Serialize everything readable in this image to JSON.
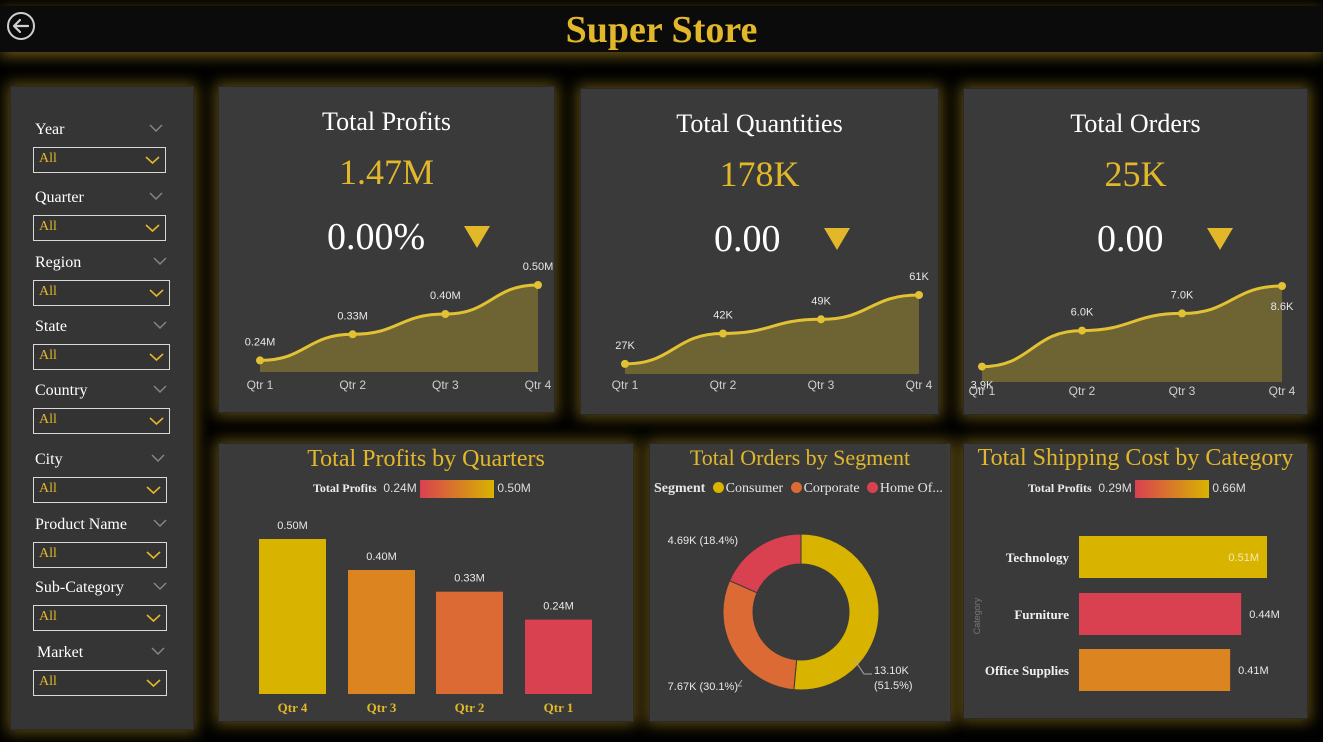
{
  "header": {
    "title": "Super Store"
  },
  "colors": {
    "gold": "#e2b82a",
    "bar_gold": "#d8b400",
    "orange": "#dc8420",
    "dark_orange": "#dc6a34",
    "red": "#d94050",
    "panel": "#3a3a3a"
  },
  "filters": [
    {
      "label": "Year",
      "value": "All"
    },
    {
      "label": "Quarter",
      "value": "All"
    },
    {
      "label": "Region",
      "value": "All"
    },
    {
      "label": "State",
      "value": "All"
    },
    {
      "label": "Country",
      "value": "All"
    },
    {
      "label": "City",
      "value": "All"
    },
    {
      "label": "Product Name",
      "value": "All"
    },
    {
      "label": "Sub-Category",
      "value": "All"
    },
    {
      "label": "Market",
      "value": "All"
    }
  ],
  "kpis": [
    {
      "title": "Total Profits",
      "value": "1.47M",
      "change": "0.00%"
    },
    {
      "title": "Total Quantities",
      "value": "178K",
      "change": "0.00"
    },
    {
      "title": "Total Orders",
      "value": "25K",
      "change": "0.00"
    }
  ],
  "bar_title": "Total Profits by Quarters",
  "bar_legend": {
    "label": "Total Profits",
    "min": "0.24M",
    "max": "0.50M"
  },
  "donut_title": "Total Orders by Segment",
  "donut_legend": {
    "label": "Segment",
    "items": [
      "Consumer",
      "Corporate",
      "Home Of..."
    ]
  },
  "hbar_title": "Total Shipping Cost by Category",
  "hbar_legend": {
    "label": "Total Profits",
    "min": "0.29M",
    "max": "0.66M"
  },
  "chart_data": [
    {
      "type": "area",
      "x": [
        "Qtr 1",
        "Qtr 2",
        "Qtr 3",
        "Qtr 4"
      ],
      "values": [
        0.24,
        0.33,
        0.4,
        0.5
      ],
      "labels": [
        "0.24M",
        "0.33M",
        "0.40M",
        "0.50M"
      ]
    },
    {
      "type": "area",
      "x": [
        "Qtr 1",
        "Qtr 2",
        "Qtr 3",
        "Qtr 4"
      ],
      "values": [
        27,
        42,
        49,
        61
      ],
      "labels": [
        "27K",
        "42K",
        "49K",
        "61K"
      ]
    },
    {
      "type": "area",
      "x": [
        "Qtr 1",
        "Qtr 2",
        "Qtr 3",
        "Qtr 4"
      ],
      "values": [
        3.9,
        6.0,
        7.0,
        8.6
      ],
      "labels": [
        "3.9K",
        "6.0K",
        "7.0K",
        "8.6K"
      ]
    },
    {
      "type": "bar",
      "categories": [
        "Qtr 4",
        "Qtr 3",
        "Qtr 2",
        "Qtr 1"
      ],
      "values": [
        0.5,
        0.4,
        0.33,
        0.24
      ],
      "labels": [
        "0.50M",
        "0.40M",
        "0.33M",
        "0.24M"
      ],
      "colors": [
        "#d8b400",
        "#dc8420",
        "#dc6a34",
        "#d94050"
      ]
    },
    {
      "type": "pie",
      "categories": [
        "Consumer",
        "Corporate",
        "Home Office"
      ],
      "values": [
        13.1,
        7.67,
        4.69
      ],
      "percent": [
        51.5,
        30.1,
        18.4
      ],
      "labels": [
        "13.10K (51.5%)",
        "7.67K (30.1%)",
        "4.69K (18.4%)"
      ],
      "colors": [
        "#d8b400",
        "#dc6a34",
        "#d94050"
      ]
    },
    {
      "type": "bar",
      "orientation": "horizontal",
      "categories": [
        "Technology",
        "Furniture",
        "Office Supplies"
      ],
      "values": [
        0.51,
        0.44,
        0.41
      ],
      "labels": [
        "0.51M",
        "0.44M",
        "0.41M"
      ],
      "ylabel": "Category",
      "colors": [
        "#d8b400",
        "#d94050",
        "#dc8420"
      ]
    }
  ]
}
